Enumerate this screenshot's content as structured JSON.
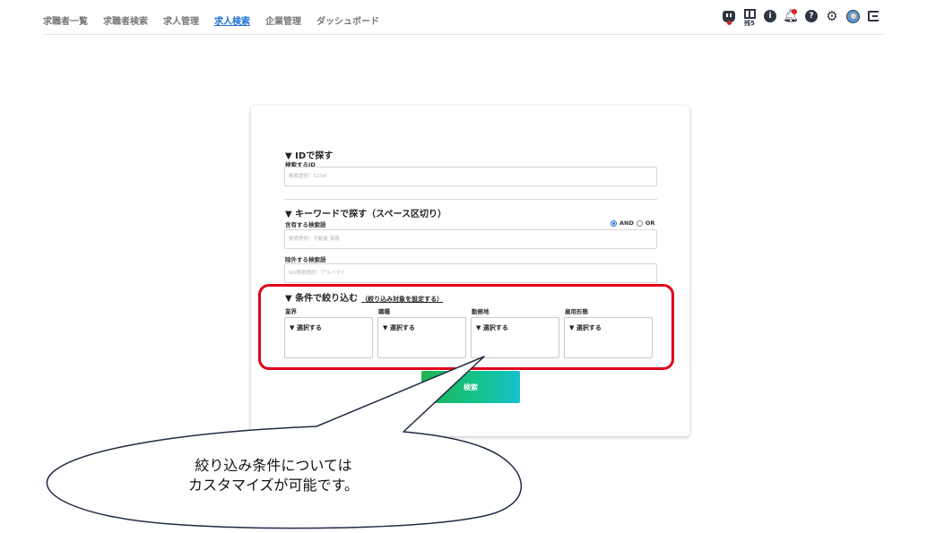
{
  "nav": {
    "links": [
      "求職者一覧",
      "求職者検索",
      "求人管理",
      "求人検索",
      "企業管理",
      "ダッシュボード"
    ],
    "active_index": 3,
    "grid_count": "残5",
    "icons": [
      "twitch-icon",
      "grid-icon",
      "info-icon",
      "bell-icon",
      "help-icon",
      "gear-icon",
      "avatar",
      "logout-icon"
    ]
  },
  "id_section": {
    "title": "▼ IDで探す",
    "label": "検索するID",
    "placeholder": "検索語例：1234"
  },
  "keyword_section": {
    "title": "▼ キーワードで探す（スペース区切り）",
    "include_label": "含有する検索語",
    "include_placeholder": "検索語例：不動産 事務",
    "and_label": "AND",
    "or_label": "OR",
    "selected_mode": "AND",
    "exclude_label": "除外する検索語",
    "exclude_placeholder": "NG検索語例：アルバイト"
  },
  "filter_section": {
    "title": "▼ 条件で絞り込む",
    "link": "（絞り込み対象を設定する）",
    "columns": [
      {
        "label": "業界",
        "select": "▼ 選択する"
      },
      {
        "label": "職種",
        "select": "▼ 選択する"
      },
      {
        "label": "勤務地",
        "select": "▼ 選択する"
      },
      {
        "label": "雇用形態",
        "select": "▼ 選択する"
      }
    ]
  },
  "search_button": "検索",
  "callout": {
    "line1": "絞り込み条件については",
    "line2": "カスタマイズが可能です。"
  },
  "colors": {
    "active_nav": "#1e6fd6",
    "highlight_border": "#e0001b",
    "button_gradient_start": "#1fb552",
    "button_gradient_end": "#13c2c8"
  }
}
